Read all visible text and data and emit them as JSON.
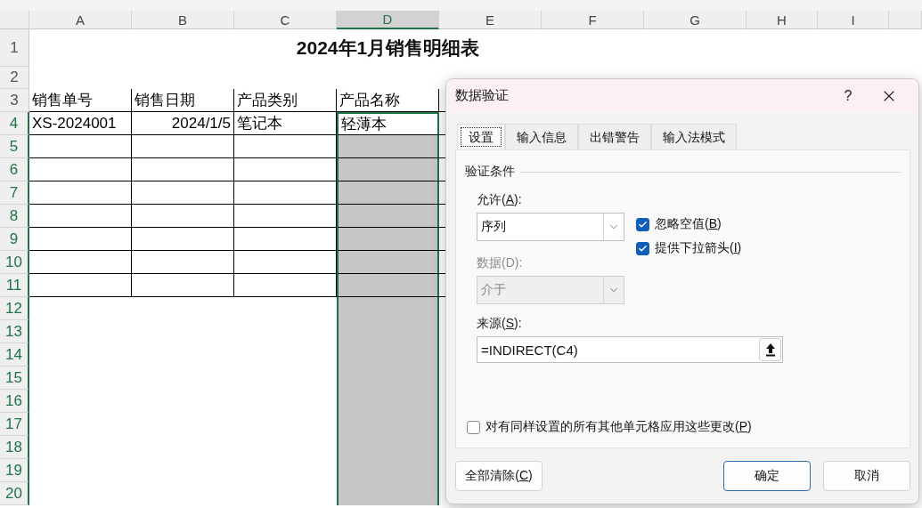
{
  "sheet": {
    "columns": [
      {
        "label": "A",
        "selected": false
      },
      {
        "label": "B",
        "selected": false
      },
      {
        "label": "C",
        "selected": false
      },
      {
        "label": "D",
        "selected": true
      },
      {
        "label": "E",
        "selected": false
      },
      {
        "label": "F",
        "selected": false
      },
      {
        "label": "G",
        "selected": false
      },
      {
        "label": "H",
        "selected": false
      },
      {
        "label": "I",
        "selected": false
      }
    ],
    "rows": [
      {
        "label": "1",
        "selected": false
      },
      {
        "label": "2",
        "selected": false
      },
      {
        "label": "3",
        "selected": false
      },
      {
        "label": "4",
        "selected": true
      },
      {
        "label": "5",
        "selected": true
      },
      {
        "label": "6",
        "selected": true
      },
      {
        "label": "7",
        "selected": true
      },
      {
        "label": "8",
        "selected": true
      },
      {
        "label": "9",
        "selected": true
      },
      {
        "label": "10",
        "selected": true
      },
      {
        "label": "11",
        "selected": true
      },
      {
        "label": "12",
        "selected": true
      },
      {
        "label": "13",
        "selected": true
      },
      {
        "label": "14",
        "selected": true
      },
      {
        "label": "15",
        "selected": true
      },
      {
        "label": "16",
        "selected": true
      },
      {
        "label": "17",
        "selected": true
      },
      {
        "label": "18",
        "selected": true
      },
      {
        "label": "19",
        "selected": true
      },
      {
        "label": "20",
        "selected": true
      }
    ],
    "title": "2024年1月销售明细表",
    "table": {
      "header": [
        "销售单号",
        "销售日期",
        "产品类别",
        "产品名称"
      ],
      "rows": [
        [
          "XS-2024001",
          "2024/1/5",
          "笔记本",
          "轻薄本"
        ]
      ]
    }
  },
  "dialog": {
    "title": "数据验证",
    "help": "?",
    "tabs": [
      {
        "label": "设置",
        "selected": true
      },
      {
        "label": "输入信息",
        "selected": false
      },
      {
        "label": "出错警告",
        "selected": false
      },
      {
        "label": "输入法模式",
        "selected": false
      }
    ],
    "group": "验证条件",
    "allow": {
      "label": {
        "before": "允许(",
        "key": "A",
        "after": "):"
      },
      "value": "序列"
    },
    "options": [
      {
        "label": {
          "before": "忽略空值(",
          "key": "B",
          "after": ")"
        },
        "checked": true
      },
      {
        "label": {
          "before": "提供下拉箭头(",
          "key": "I",
          "after": ")"
        },
        "checked": true
      }
    ],
    "data": {
      "label": "数据(D):",
      "value": "介于",
      "disabled": true
    },
    "source": {
      "label": {
        "before": "来源(",
        "key": "S",
        "after": "):"
      },
      "value": "=INDIRECT(C4)"
    },
    "apply_all": {
      "label": {
        "before": "对有同样设置的所有其他单元格应用这些更改(",
        "key": "P",
        "after": ")"
      },
      "checked": false
    },
    "buttons": [
      {
        "label": {
          "before": "全部清除(",
          "key": "C",
          "after": ")"
        },
        "default": false
      },
      {
        "label": {
          "before": "确定"
        },
        "default": true
      },
      {
        "label": {
          "before": "取消"
        },
        "default": false
      }
    ]
  }
}
